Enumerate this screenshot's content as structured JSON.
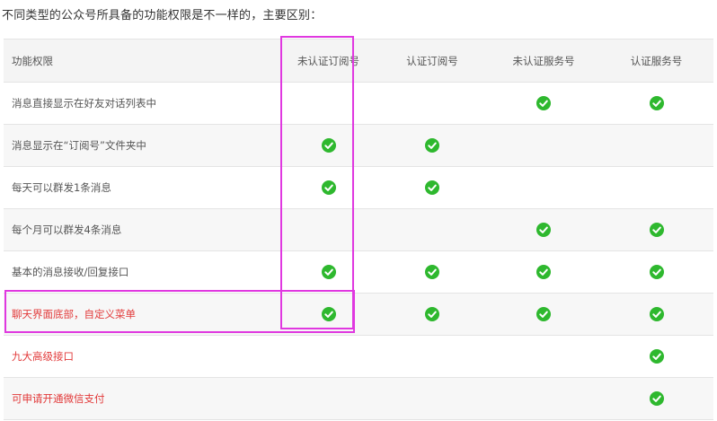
{
  "intro_text": "不同类型的公众号所具备的功能权限是不一样的，主要区别：",
  "table": {
    "headers": [
      "功能权限",
      "未认证订阅号",
      "认证订阅号",
      "未认证服务号",
      "认证服务号"
    ],
    "rows": [
      {
        "label": "消息直接显示在好友对话列表中",
        "marks": [
          false,
          false,
          true,
          true
        ]
      },
      {
        "label": "消息显示在“订阅号”文件夹中",
        "marks": [
          true,
          true,
          false,
          false
        ]
      },
      {
        "label": "每天可以群发1条消息",
        "marks": [
          true,
          true,
          false,
          false
        ]
      },
      {
        "label": "每个月可以群发4条消息",
        "marks": [
          false,
          false,
          true,
          true
        ]
      },
      {
        "label": "基本的消息接收/回复接口",
        "marks": [
          true,
          true,
          true,
          true
        ]
      },
      {
        "label": "聊天界面底部，自定义菜单",
        "marks": [
          true,
          true,
          true,
          true
        ],
        "red": true
      },
      {
        "label": "九大高级接口",
        "marks": [
          false,
          false,
          false,
          true
        ],
        "red": true
      },
      {
        "label": "可申请开通微信支付",
        "marks": [
          false,
          false,
          false,
          true
        ],
        "red": true
      }
    ]
  },
  "colors": {
    "check_green": "#2eb82e",
    "highlight_magenta": "#e038e0",
    "red_text": "#e23a3a"
  },
  "icons": {
    "check": "check-circle-icon"
  }
}
